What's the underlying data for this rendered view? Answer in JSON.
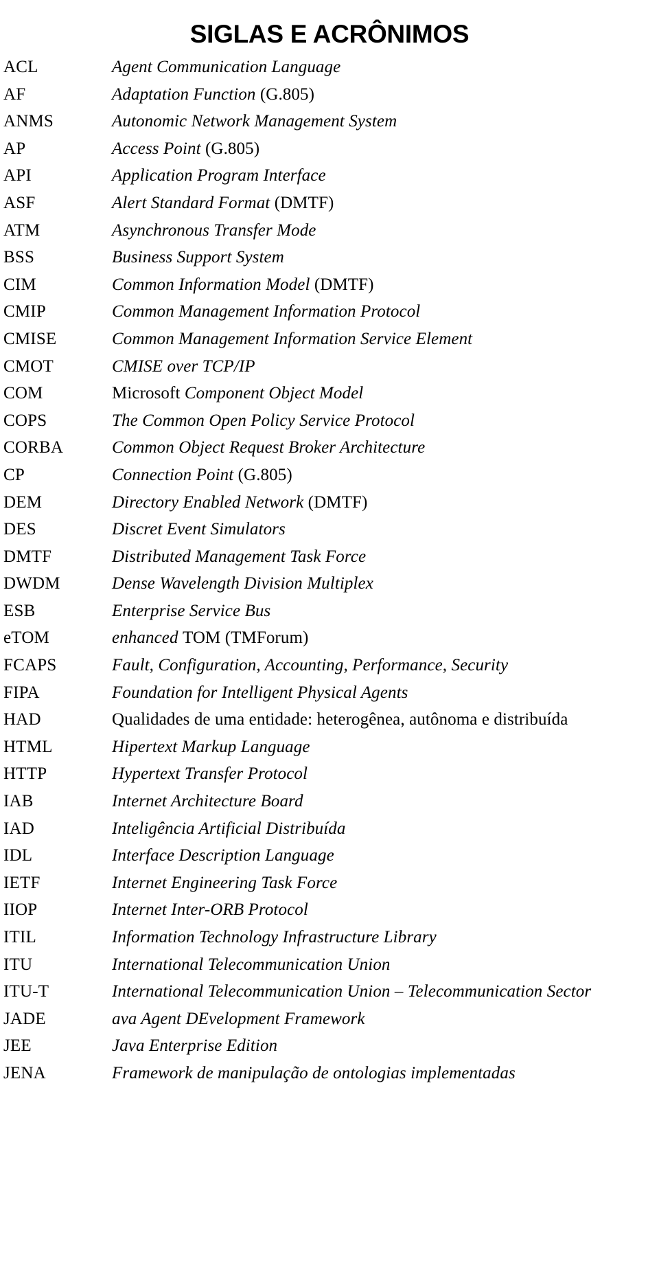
{
  "document": {
    "title": "SIGLAS E ACRÔNIMOS"
  },
  "glossary": {
    "entries": [
      {
        "term": "ACL",
        "definition": "Agent Communication Language",
        "italic": true,
        "roman_suffix": ""
      },
      {
        "term": "AF",
        "definition": "Adaptation Function ",
        "italic": true,
        "roman_suffix": "(G.805)"
      },
      {
        "term": "ANMS",
        "definition": "Autonomic Network Management System",
        "italic": true,
        "roman_suffix": ""
      },
      {
        "term": "AP",
        "definition": "Access Point ",
        "italic": true,
        "roman_suffix": "(G.805)"
      },
      {
        "term": "API",
        "definition": "Application Program Interface",
        "italic": true,
        "roman_suffix": ""
      },
      {
        "term": "ASF",
        "definition": "Alert Standard Format ",
        "italic": true,
        "roman_suffix": "(DMTF)"
      },
      {
        "term": "ATM",
        "definition": "Asynchronous Transfer Mode",
        "italic": true,
        "roman_suffix": ""
      },
      {
        "term": "BSS",
        "definition": "Business Support System",
        "italic": true,
        "roman_suffix": ""
      },
      {
        "term": "CIM",
        "definition": "Common Information Model ",
        "italic": true,
        "roman_suffix": "(DMTF)"
      },
      {
        "term": "CMIP",
        "definition": "Common Management Information Protocol",
        "italic": true,
        "roman_suffix": ""
      },
      {
        "term": "CMISE",
        "definition": "Common Management Information Service Element",
        "italic": true,
        "roman_suffix": ""
      },
      {
        "term": "CMOT",
        "definition": "CMISE over TCP/IP",
        "italic": true,
        "roman_suffix": ""
      },
      {
        "term": "COM",
        "definition": "Component Object Model",
        "italic": true,
        "roman_prefix": "Microsoft ",
        "roman_suffix": ""
      },
      {
        "term": "COPS",
        "definition": "The Common Open Policy Service Protocol",
        "italic": true,
        "roman_suffix": ""
      },
      {
        "term": "CORBA",
        "definition": "Common Object Request Broker Architecture",
        "italic": true,
        "roman_suffix": ""
      },
      {
        "term": "CP",
        "definition": "Connection Point ",
        "italic": true,
        "roman_suffix": "(G.805)"
      },
      {
        "term": "DEM",
        "definition": "Directory Enabled Network ",
        "italic": true,
        "roman_suffix": "(DMTF)"
      },
      {
        "term": "DES",
        "definition": "Discret Event Simulators",
        "italic": true,
        "roman_suffix": ""
      },
      {
        "term": "DMTF",
        "definition": "Distributed Management Task Force",
        "italic": true,
        "roman_suffix": ""
      },
      {
        "term": "DWDM",
        "definition": "Dense Wavelength Division Multiplex",
        "italic": true,
        "roman_suffix": ""
      },
      {
        "term": "ESB",
        "definition": "Enterprise Service Bus",
        "italic": true,
        "roman_suffix": ""
      },
      {
        "term": "eTOM",
        "definition": "enhanced ",
        "italic": true,
        "roman_suffix": "TOM (TMForum)"
      },
      {
        "term": "FCAPS",
        "definition": "Fault, Configuration, Accounting, Performance, Security",
        "italic": true,
        "roman_suffix": ""
      },
      {
        "term": "FIPA",
        "definition": "Foundation for Intelligent Physical Agents",
        "italic": true,
        "roman_suffix": ""
      },
      {
        "term": "HAD",
        "definition": "Qualidades de uma entidade: heterogênea, autônoma e distribuída",
        "italic": false,
        "roman_suffix": ""
      },
      {
        "term": "HTML",
        "definition": "Hipertext Markup Language",
        "italic": true,
        "roman_suffix": ""
      },
      {
        "term": "HTTP",
        "definition": "Hypertext Transfer Protocol",
        "italic": true,
        "roman_suffix": ""
      },
      {
        "term": "IAB",
        "definition": "Internet Architecture Board",
        "italic": true,
        "roman_suffix": ""
      },
      {
        "term": "IAD",
        "definition": "Inteligência Artificial Distribuída",
        "italic": true,
        "roman_suffix": ""
      },
      {
        "term": "IDL",
        "definition": "Interface Description Language",
        "italic": true,
        "roman_suffix": ""
      },
      {
        "term": "IETF",
        "definition": "Internet Engineering Task Force",
        "italic": true,
        "roman_suffix": ""
      },
      {
        "term": "IIOP",
        "definition": "Internet Inter-ORB Protocol",
        "italic": true,
        "roman_suffix": ""
      },
      {
        "term": "ITIL",
        "definition": "Information Technology Infrastructure Library",
        "italic": true,
        "roman_suffix": ""
      },
      {
        "term": "ITU",
        "definition": "International Telecommunication Union",
        "italic": true,
        "roman_suffix": ""
      },
      {
        "term": "ITU-T",
        "definition": "International Telecommunication Union – Telecommunication Sector",
        "italic": true,
        "roman_suffix": ""
      },
      {
        "term": "JADE",
        "definition": "ava Agent DEvelopment Framework",
        "italic": true,
        "roman_suffix": ""
      },
      {
        "term": "JEE",
        "definition": "Java Enterprise Edition",
        "italic": true,
        "roman_suffix": ""
      },
      {
        "term": "JENA",
        "definition": "Framework de manipulação de ontologias implementadas",
        "italic": true,
        "roman_suffix": ""
      }
    ]
  }
}
